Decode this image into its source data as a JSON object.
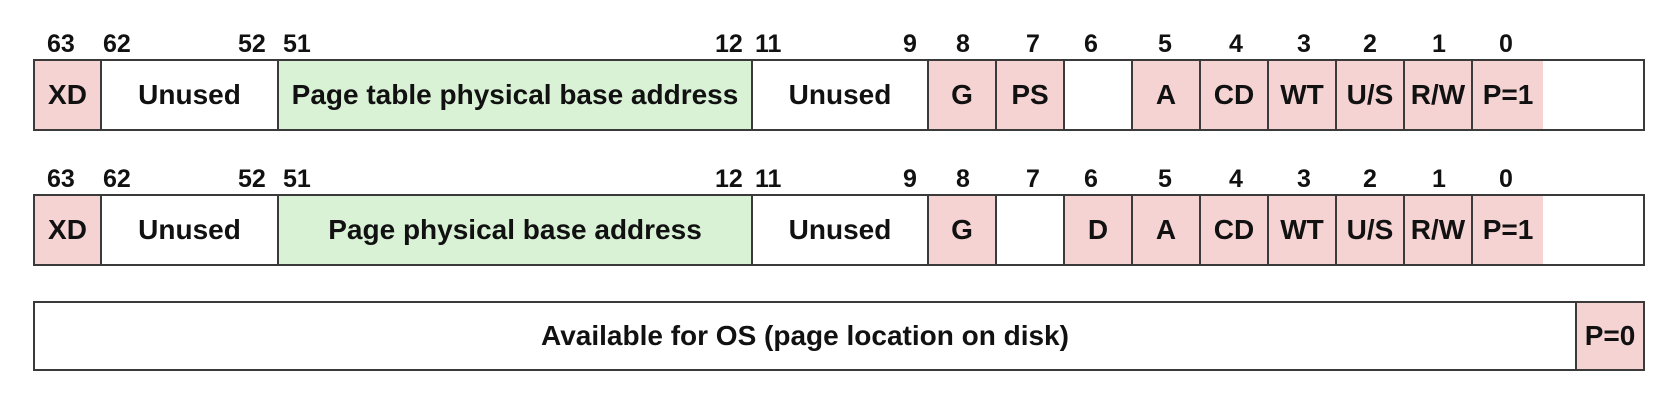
{
  "colors": {
    "flag": "#f6d3d3",
    "address": "#d9f2d6",
    "unused": "#ffffff",
    "border": "#3a3a3a"
  },
  "rows": [
    {
      "bit_labels": [
        "63",
        "62",
        "52",
        "51",
        "12",
        "11",
        "9",
        "8",
        "7",
        "6",
        "5",
        "4",
        "3",
        "2",
        "1",
        "0"
      ],
      "fields": [
        {
          "label": "XD",
          "color": "pink"
        },
        {
          "label": "Unused",
          "color": "white"
        },
        {
          "label": "Page table physical base address",
          "color": "green"
        },
        {
          "label": "Unused",
          "color": "white"
        },
        {
          "label": "G",
          "color": "pink"
        },
        {
          "label": "PS",
          "color": "pink"
        },
        {
          "label": "",
          "color": "white"
        },
        {
          "label": "A",
          "color": "pink"
        },
        {
          "label": "CD",
          "color": "pink"
        },
        {
          "label": "WT",
          "color": "pink"
        },
        {
          "label": "U/S",
          "color": "pink"
        },
        {
          "label": "R/W",
          "color": "pink"
        },
        {
          "label": "P=1",
          "color": "pink"
        }
      ]
    },
    {
      "bit_labels": [
        "63",
        "62",
        "52",
        "51",
        "12",
        "11",
        "9",
        "8",
        "7",
        "6",
        "5",
        "4",
        "3",
        "2",
        "1",
        "0"
      ],
      "fields": [
        {
          "label": "XD",
          "color": "pink"
        },
        {
          "label": "Unused",
          "color": "white"
        },
        {
          "label": "Page physical base address",
          "color": "green"
        },
        {
          "label": "Unused",
          "color": "white"
        },
        {
          "label": "G",
          "color": "pink"
        },
        {
          "label": "",
          "color": "white"
        },
        {
          "label": "D",
          "color": "pink"
        },
        {
          "label": "A",
          "color": "pink"
        },
        {
          "label": "CD",
          "color": "pink"
        },
        {
          "label": "WT",
          "color": "pink"
        },
        {
          "label": "U/S",
          "color": "pink"
        },
        {
          "label": "R/W",
          "color": "pink"
        },
        {
          "label": "P=1",
          "color": "pink"
        }
      ]
    },
    {
      "bit_labels": [],
      "fields": [
        {
          "label": "Available for OS (page location on disk)",
          "color": "white"
        },
        {
          "label": "P=0",
          "color": "pink"
        }
      ]
    }
  ]
}
